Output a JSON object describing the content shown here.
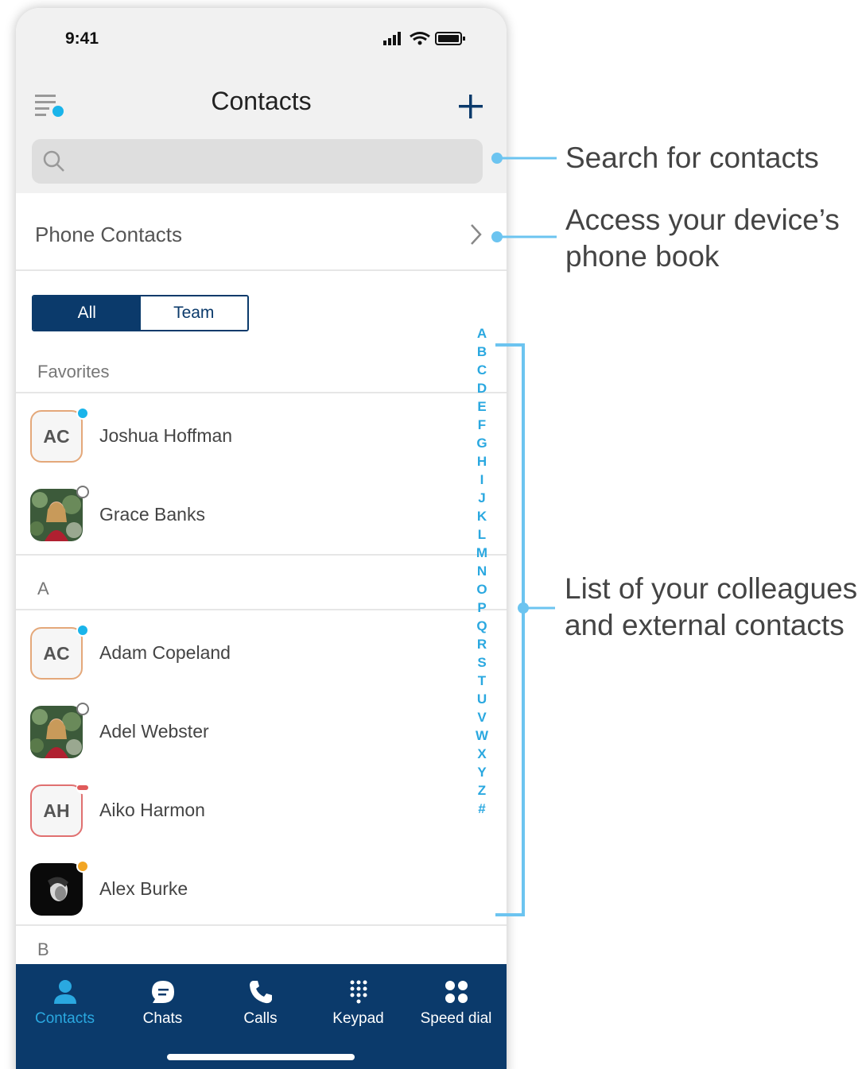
{
  "status_bar": {
    "time": "9:41"
  },
  "header": {
    "title": "Contacts"
  },
  "search": {
    "placeholder": ""
  },
  "phone_contacts": {
    "label": "Phone Contacts"
  },
  "segment": {
    "all": "All",
    "team": "Team"
  },
  "favorites": {
    "header": "Favorites",
    "contacts": [
      {
        "name": "Joshua Hoffman",
        "initials": "AC",
        "presence": "available"
      },
      {
        "name": "Grace Banks",
        "initials": "",
        "presence": "offline"
      }
    ]
  },
  "section_a": {
    "header": "A",
    "contacts": [
      {
        "name": "Adam Copeland",
        "initials": "AC",
        "presence": "available"
      },
      {
        "name": "Adel Webster",
        "initials": "",
        "presence": "offline"
      },
      {
        "name": "Aiko Harmon",
        "initials": "AH",
        "presence": "busy"
      },
      {
        "name": "Alex Burke",
        "initials": "",
        "presence": "away"
      }
    ]
  },
  "section_b": {
    "header": "B"
  },
  "alpha_index": [
    "A",
    "B",
    "C",
    "D",
    "E",
    "F",
    "G",
    "H",
    "I",
    "J",
    "K",
    "L",
    "M",
    "N",
    "O",
    "P",
    "Q",
    "R",
    "S",
    "T",
    "U",
    "V",
    "W",
    "X",
    "Y",
    "Z",
    "#"
  ],
  "nav": {
    "contacts": "Contacts",
    "chats": "Chats",
    "calls": "Calls",
    "keypad": "Keypad",
    "speed_dial": "Speed dial"
  },
  "annotations": {
    "search": "Search for contacts",
    "phone_book_line1": "Access your device’s",
    "phone_book_line2": "phone book",
    "list_line1": "List of your colleagues",
    "list_line2": "and external contacts"
  },
  "colors": {
    "navy": "#0b3a6b",
    "accent": "#2aa8e0",
    "available": "#1ab4ea",
    "busy": "#e05a5a",
    "away": "#f2a523",
    "annotation_line": "#6cc4f0"
  },
  "icons": {
    "menu": "menu-icon",
    "add": "plus-icon",
    "search": "search-icon",
    "chevron": "chevron-right-icon",
    "nav_contacts": "person-icon",
    "nav_chats": "chat-bubble-icon",
    "nav_calls": "phone-icon",
    "nav_keypad": "keypad-icon",
    "nav_speed_dial": "speed-dial-icon"
  }
}
